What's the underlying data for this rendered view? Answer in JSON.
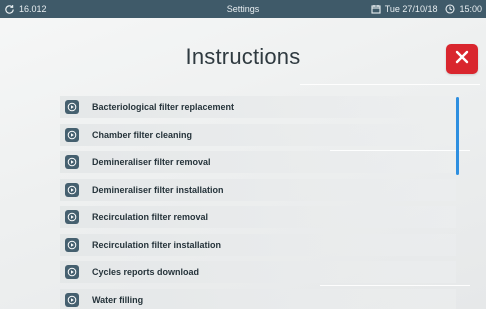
{
  "status_bar": {
    "left_value": "16.012",
    "title": "Settings",
    "date": "Tue 27/10/18",
    "time": "15:00"
  },
  "page": {
    "title": "Instructions"
  },
  "colors": {
    "status_bar_bg": "#3f5a69",
    "close_button_bg": "#d9262e",
    "item_icon_bg": "#45606f",
    "scrollbar": "#2e8fe0"
  },
  "icons": {
    "status_left": "refresh-icon",
    "date": "calendar-icon",
    "time": "clock-icon",
    "close": "close-icon",
    "item": "play-circle-icon"
  },
  "instructions": [
    {
      "label": "Bacteriological filter replacement"
    },
    {
      "label": "Chamber filter cleaning"
    },
    {
      "label": "Demineraliser filter removal"
    },
    {
      "label": "Demineraliser filter installation"
    },
    {
      "label": "Recirculation filter removal"
    },
    {
      "label": "Recirculation filter installation"
    },
    {
      "label": "Cycles reports download"
    },
    {
      "label": "Water filling"
    }
  ]
}
